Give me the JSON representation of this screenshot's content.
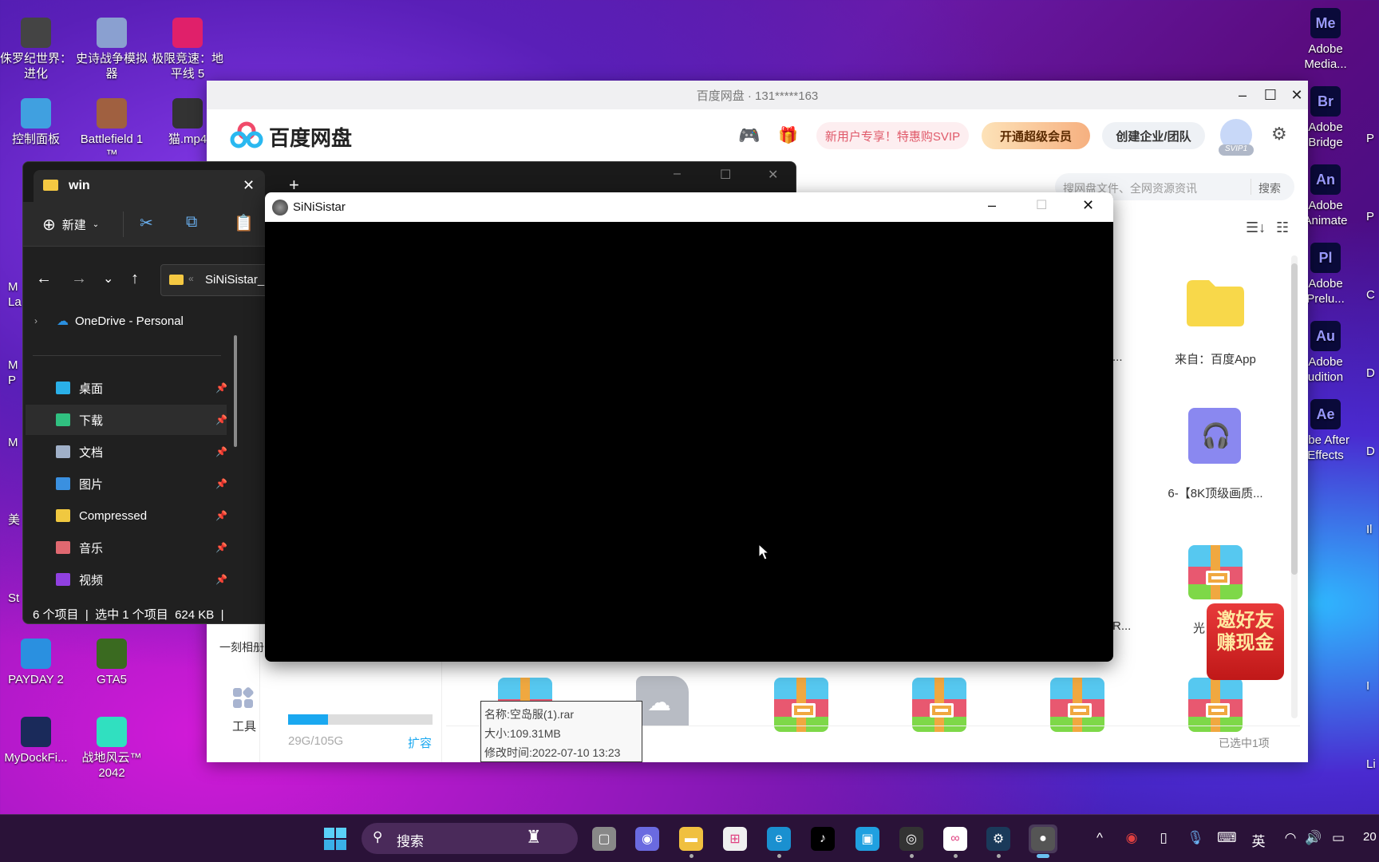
{
  "desktop": {
    "left_icons": [
      {
        "label": "侏罗纪世界：\n进化",
        "icon": "jurassic-icon"
      },
      {
        "label": "史诗战争模拟\n器",
        "icon": "uebs-icon"
      },
      {
        "label": "极限竞速：地\n平线 5",
        "icon": "forza-icon"
      },
      {
        "label": "控制面板",
        "icon": "control-panel-icon"
      },
      {
        "label": "Battlefield 1\n™",
        "icon": "battlefield-icon"
      },
      {
        "label": "猫.mp4",
        "icon": "video-file-icon"
      },
      {
        "label": "PAYDAY 2",
        "icon": "payday-icon"
      },
      {
        "label": "GTA5",
        "icon": "gta-icon"
      },
      {
        "label": "MyDockFi...",
        "icon": "mydock-icon"
      },
      {
        "label": "战地风云™\n2042",
        "icon": "bf2042-icon"
      }
    ],
    "left_partials": [
      "M\nLa",
      "M\nP",
      "M",
      "美",
      "St"
    ],
    "right_icons": [
      {
        "abbr": "Me",
        "label": "Adobe\nMedia..."
      },
      {
        "abbr": "Br",
        "label": "Adobe\nBridge"
      },
      {
        "abbr": "An",
        "label": "Adobe\nAnimate"
      },
      {
        "abbr": "Pl",
        "label": "Adobe\nPrelu..."
      },
      {
        "abbr": "Au",
        "label": "Adobe\nudition"
      },
      {
        "abbr": "Ae",
        "label": "obe After\nEffects"
      }
    ],
    "right_partials": [
      "P",
      "P",
      "C",
      "D",
      "D",
      "Il",
      "I",
      "Li"
    ]
  },
  "baidu": {
    "title": "百度网盘 · 131*****163",
    "logo_text": "百度网盘",
    "promo": "新用户专享！特惠购SVIP",
    "vip_button": "开通超级会员",
    "team_button": "创建企业/团队",
    "avatar_badge": "SVIP1",
    "search_placeholder": "搜网盘文件、全网资源资讯",
    "search_button": "搜索",
    "nav_album": "一刻相册",
    "nav_tools": "工具",
    "storage_text": "29G/105G",
    "storage_used_fraction": 0.276,
    "expand": "扩容",
    "files": [
      {
        "label": "来自：百度App",
        "type": "folder"
      },
      {
        "label": "6-【8K顶级画质...",
        "type": "audio"
      },
      {
        "label": "光",
        "type": "rar"
      }
    ],
    "partial_labels": [
      "...",
      "R..."
    ],
    "selection_status": "已选中1项",
    "ad_text": "邀好友\n赚现金",
    "tooltip": {
      "name": "名称:空岛服(1).rar",
      "size": "大小:109.31MB",
      "modified": "修改时间:2022-07-10 13:23"
    }
  },
  "explorer": {
    "tab": "win",
    "new_button": "新建",
    "address": "SiNiSistar_",
    "onedrive": "OneDrive - Personal",
    "quick_access": [
      {
        "label": "桌面",
        "color": "#2ab0e8"
      },
      {
        "label": "下载",
        "color": "#30c080"
      },
      {
        "label": "文档",
        "color": "#a0b0c8"
      },
      {
        "label": "图片",
        "color": "#3a90e0"
      },
      {
        "label": "Compressed",
        "color": "#f0c840"
      },
      {
        "label": "音乐",
        "color": "#e06870"
      },
      {
        "label": "视频",
        "color": "#9040e0"
      }
    ],
    "status": "6 个项目  |  选中 1 个项目  624 KB  |"
  },
  "sinisistar": {
    "title": "SiNiSistar"
  },
  "taskbar": {
    "search_label": "搜索",
    "apps": [
      "task-view",
      "teams",
      "file-explorer",
      "store",
      "edge",
      "tiktok",
      "bilibili",
      "obs",
      "baidu-netdisk",
      "steam",
      "sinisistar"
    ],
    "tray_lang": "英",
    "clock_partial": "20"
  }
}
